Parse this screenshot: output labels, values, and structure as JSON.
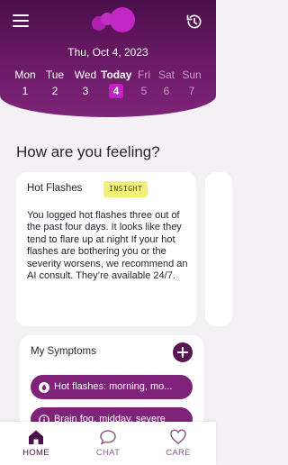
{
  "header": {
    "date": "Thu, Oct 4, 2023",
    "week": [
      {
        "name": "Mon",
        "num": "1",
        "state": "past"
      },
      {
        "name": "Tue",
        "num": "2",
        "state": "past"
      },
      {
        "name": "Wed",
        "num": "3",
        "state": "past"
      },
      {
        "name": "Today",
        "num": "4",
        "state": "today"
      },
      {
        "name": "Fri",
        "num": "5",
        "state": "future"
      },
      {
        "name": "Sat",
        "num": "6",
        "state": "future"
      },
      {
        "name": "Sun",
        "num": "7",
        "state": "future"
      }
    ]
  },
  "main": {
    "title": "How are you feeling?",
    "insight_card": {
      "title": "Hot Flashes",
      "badge": "INSIGHT",
      "body": "You logged hot flashes three out of the past four days. It looks like they tend to flare up at night If your hot flashes are bothering you or the severity worsens, we recommend an AI consult. They’re available 24/7."
    },
    "symptoms": {
      "title": "My Symptoms",
      "items": [
        {
          "label": "Hot flashes: morning, mo...",
          "icon": "flame-icon"
        },
        {
          "label": "Brain fog: midday, severe",
          "icon": "info-icon"
        }
      ]
    }
  },
  "tabbar": {
    "tabs": [
      {
        "label": "HOME",
        "icon": "home-icon",
        "active": true
      },
      {
        "label": "CHAT",
        "icon": "chat-icon",
        "active": false
      },
      {
        "label": "CARE",
        "icon": "heart-icon",
        "active": false
      }
    ]
  },
  "colors": {
    "header": "#5a1456",
    "today": "#c321c3",
    "chip": "#7f227a",
    "badge": "#f1f178"
  }
}
